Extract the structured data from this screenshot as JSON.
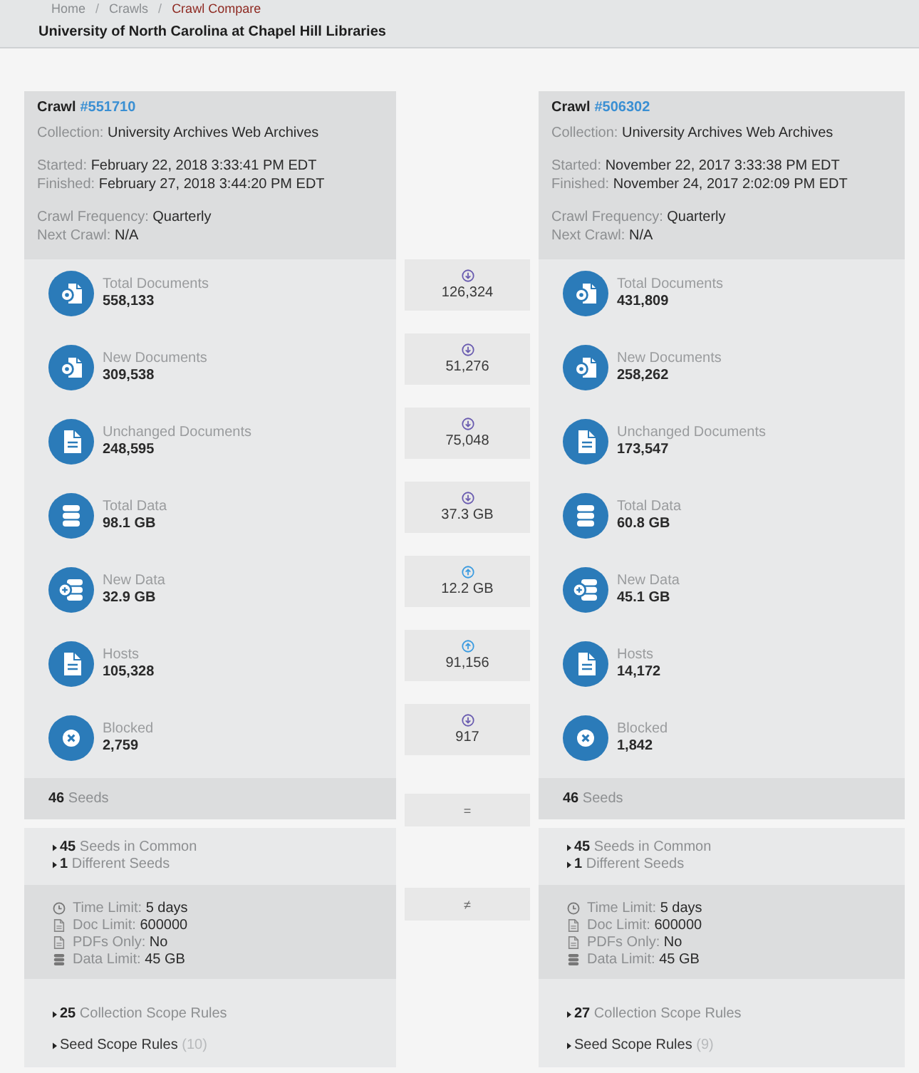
{
  "breadcrumb": {
    "separator": "/",
    "items": [
      {
        "label": "Home",
        "current": false
      },
      {
        "label": "Crawls",
        "current": false
      },
      {
        "label": "Crawl Compare",
        "current": true
      }
    ]
  },
  "title": "University of North Carolina at Chapel Hill Libraries",
  "crawls": [
    {
      "heading": "Crawl",
      "link": "#551710",
      "detail_groups": [
        [
          {
            "label": "Collection:",
            "value": "University Archives Web Archives"
          }
        ],
        [
          {
            "label": "Started:",
            "value": "February 22, 2018 3:33:41 PM EDT"
          },
          {
            "label": "Finished:",
            "value": "February 27, 2018 3:44:20 PM EDT"
          }
        ],
        [
          {
            "label": "Crawl Frequency:",
            "value": "Quarterly"
          },
          {
            "label": "Next Crawl:",
            "value": "N/A"
          }
        ]
      ],
      "stats": [
        {
          "kind": "documents",
          "label": "Total Documents",
          "value": "558,133"
        },
        {
          "kind": "documents",
          "label": "New Documents",
          "value": "309,538"
        },
        {
          "kind": "file",
          "label": "Unchanged Documents",
          "value": "248,595"
        },
        {
          "kind": "database",
          "label": "Total Data",
          "value": "98.1 GB"
        },
        {
          "kind": "database-new",
          "label": "New Data",
          "value": "32.9 GB"
        },
        {
          "kind": "file",
          "label": "Hosts",
          "value": "105,328"
        },
        {
          "kind": "blocked",
          "label": "Blocked",
          "value": "2,759"
        }
      ],
      "seeds": {
        "count": "46",
        "label": "Seeds"
      },
      "seed_groups": [
        {
          "count": "45",
          "label": "Seeds in Common",
          "expanded": false
        },
        {
          "count": "1",
          "label": "Different Seeds",
          "expanded": false
        }
      ],
      "limits": [
        {
          "kind": "time",
          "label": "Time Limit:",
          "value": "5 days"
        },
        {
          "kind": "document",
          "label": "Doc Limit:",
          "value": "600000"
        },
        {
          "kind": "document",
          "label": "PDFs Only:",
          "value": "No"
        },
        {
          "kind": "data",
          "label": "Data Limit:",
          "value": "45 GB"
        }
      ],
      "scope_rules": [
        {
          "kind": "collection",
          "count": "25",
          "label": "Collection Scope Rules",
          "expanded": false
        },
        {
          "kind": "seed",
          "label": "Seed Scope Rules",
          "count": "(10)",
          "expanded": false
        }
      ]
    },
    {
      "heading": "Crawl",
      "link": "#506302",
      "detail_groups": [
        [
          {
            "label": "Collection:",
            "value": "University Archives Web Archives"
          }
        ],
        [
          {
            "label": "Started:",
            "value": "November 22, 2017 3:33:38 PM EDT"
          },
          {
            "label": "Finished:",
            "value": "November 24, 2017 2:02:09 PM EDT"
          }
        ],
        [
          {
            "label": "Crawl Frequency:",
            "value": "Quarterly"
          },
          {
            "label": "Next Crawl:",
            "value": "N/A"
          }
        ]
      ],
      "stats": [
        {
          "kind": "documents",
          "label": "Total Documents",
          "value": "431,809"
        },
        {
          "kind": "documents",
          "label": "New Documents",
          "value": "258,262"
        },
        {
          "kind": "file",
          "label": "Unchanged Documents",
          "value": "173,547"
        },
        {
          "kind": "database",
          "label": "Total Data",
          "value": "60.8 GB"
        },
        {
          "kind": "database-new",
          "label": "New Data",
          "value": "45.1 GB"
        },
        {
          "kind": "file",
          "label": "Hosts",
          "value": "14,172"
        },
        {
          "kind": "blocked",
          "label": "Blocked",
          "value": "1,842"
        }
      ],
      "seeds": {
        "count": "46",
        "label": "Seeds"
      },
      "seed_groups": [
        {
          "count": "45",
          "label": "Seeds in Common",
          "expanded": false
        },
        {
          "count": "1",
          "label": "Different Seeds",
          "expanded": false
        }
      ],
      "limits": [
        {
          "kind": "time",
          "label": "Time Limit:",
          "value": "5 days"
        },
        {
          "kind": "document",
          "label": "Doc Limit:",
          "value": "600000"
        },
        {
          "kind": "document",
          "label": "PDFs Only:",
          "value": "No"
        },
        {
          "kind": "data",
          "label": "Data Limit:",
          "value": "45 GB"
        }
      ],
      "scope_rules": [
        {
          "kind": "collection",
          "count": "27",
          "label": "Collection Scope Rules",
          "expanded": false
        },
        {
          "kind": "seed",
          "label": "Seed Scope Rules",
          "count": "(9)",
          "expanded": false
        }
      ]
    }
  ],
  "diffs": [
    {
      "increase": false,
      "value": "126,324"
    },
    {
      "increase": false,
      "value": "51,276"
    },
    {
      "increase": false,
      "value": "75,048"
    },
    {
      "increase": false,
      "value": "37.3 GB"
    },
    {
      "increase": true,
      "value": "12.2 GB"
    },
    {
      "increase": true,
      "value": "91,156"
    },
    {
      "increase": false,
      "value": "917"
    }
  ],
  "seeds_comparison": "=",
  "limits_comparison": "≠"
}
